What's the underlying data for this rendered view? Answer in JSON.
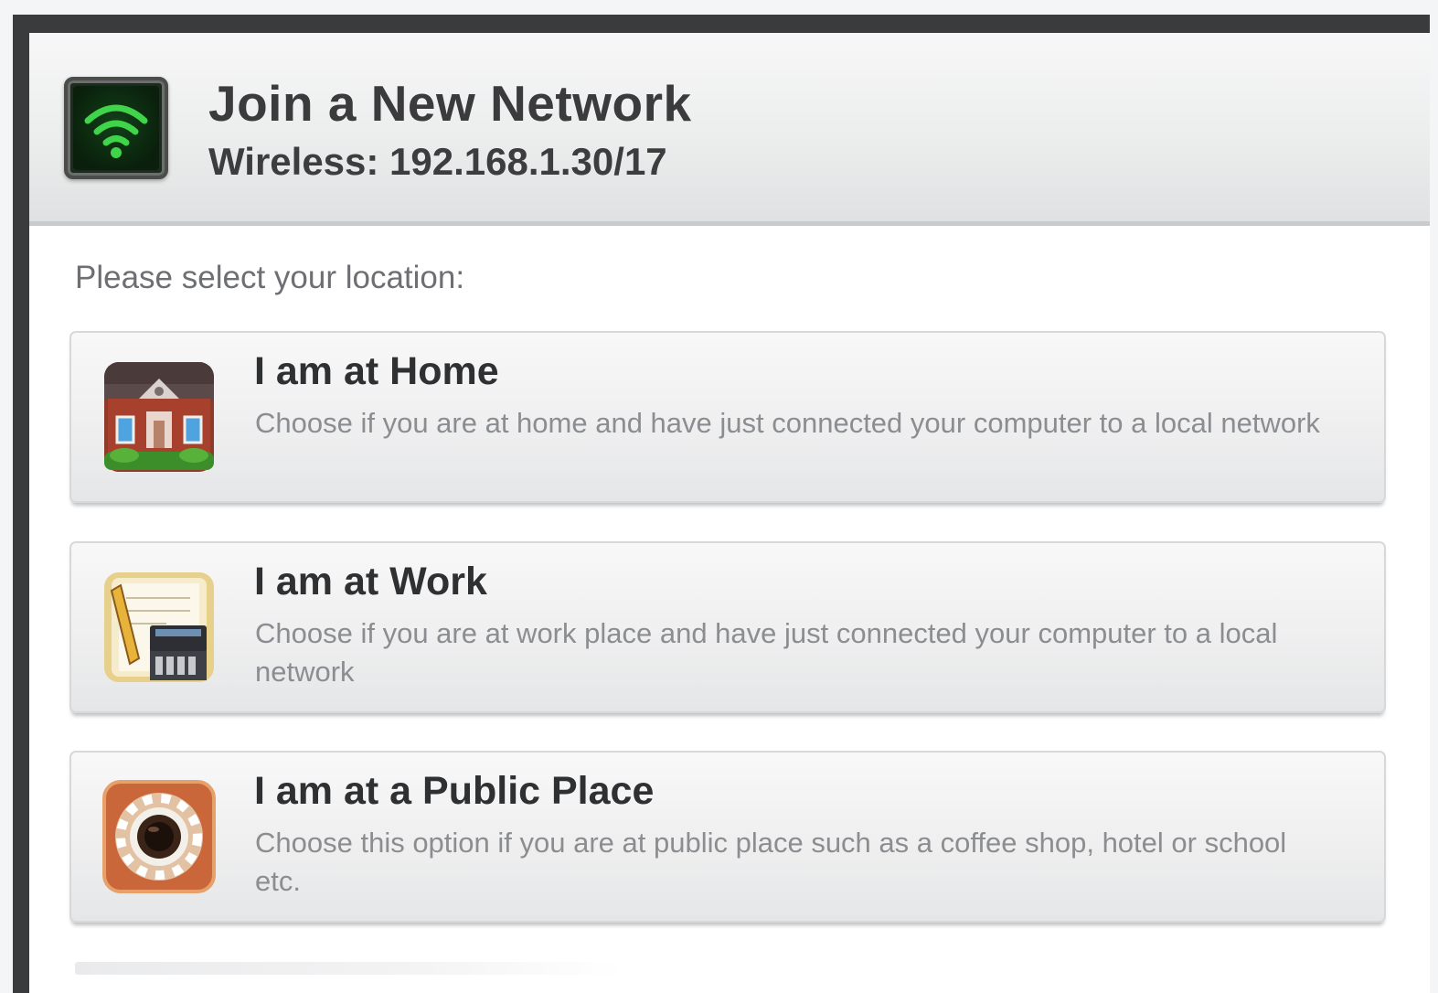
{
  "header": {
    "icon": "wifi-icon",
    "title": "Join a New Network",
    "subtitle": "Wireless: 192.168.1.30/17"
  },
  "prompt": "Please select your location:",
  "options": [
    {
      "icon": "home-icon",
      "title": "I am at Home",
      "description": "Choose if you are at home and have just connected your computer to a local network"
    },
    {
      "icon": "work-icon",
      "title": "I am at Work",
      "description": "Choose if you are at work place and have just connected your computer to a local network"
    },
    {
      "icon": "public-place-icon",
      "title": "I am at a Public Place",
      "description": "Choose this option if you are at public place such as a coffee shop, hotel or school etc."
    }
  ],
  "colors": {
    "window_frame": "#3a3b3d",
    "wifi_green": "#3fd44a",
    "title_text": "#3b3b3d",
    "description_text": "#8c8d90"
  }
}
